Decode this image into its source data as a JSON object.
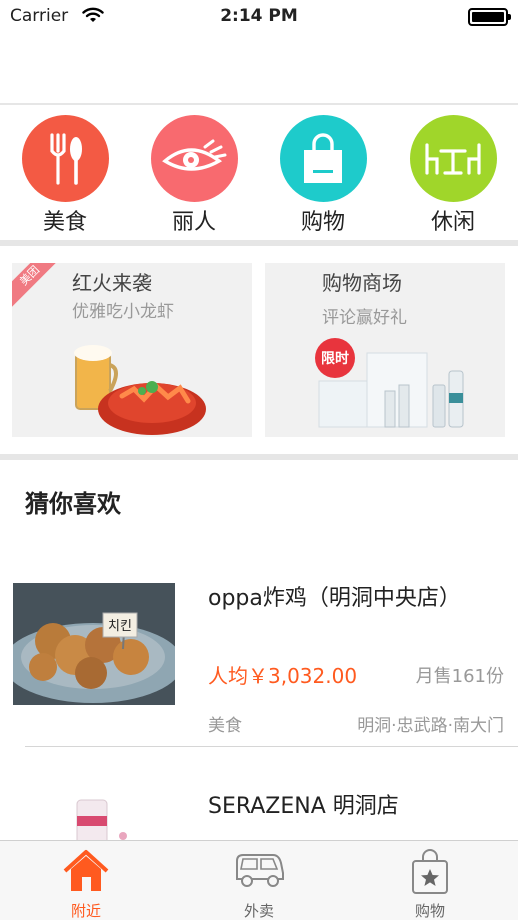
{
  "status_bar": {
    "carrier": "Carrier",
    "time": "2:14 PM"
  },
  "categories": [
    {
      "label": "美食",
      "icon": "fork-spoon-icon",
      "color": "#f35a44"
    },
    {
      "label": "丽人",
      "icon": "eye-icon",
      "color": "#f86a6f"
    },
    {
      "label": "购物",
      "icon": "shopping-bag-icon",
      "color": "#1ecbcb"
    },
    {
      "label": "休闲",
      "icon": "table-chairs-icon",
      "color": "#a0d62a"
    }
  ],
  "promos": [
    {
      "title": "红火来袭",
      "subtitle": "优雅吃小龙虾",
      "corner_tag": "美团"
    },
    {
      "title": "购物商场",
      "subtitle": "评论赢好礼",
      "badge": "限时"
    }
  ],
  "section": {
    "title": "猜你喜欢"
  },
  "items": [
    {
      "name": "oppa炸鸡（明洞中央店）",
      "price": "人均￥3,032.00",
      "sales": "月售161份",
      "category": "美食",
      "area": "明洞·忠武路·南大门",
      "flag_text": "치킨"
    },
    {
      "name": "SERAZENA 明洞店"
    }
  ],
  "tabbar": [
    {
      "label": "附近",
      "icon": "house-icon",
      "active": true
    },
    {
      "label": "外卖",
      "icon": "van-icon",
      "active": false
    },
    {
      "label": "购物",
      "icon": "shopping-bag-star-icon",
      "active": false
    }
  ],
  "colors": {
    "accent": "#ff5a1f",
    "divider": "#e6e6e6"
  }
}
